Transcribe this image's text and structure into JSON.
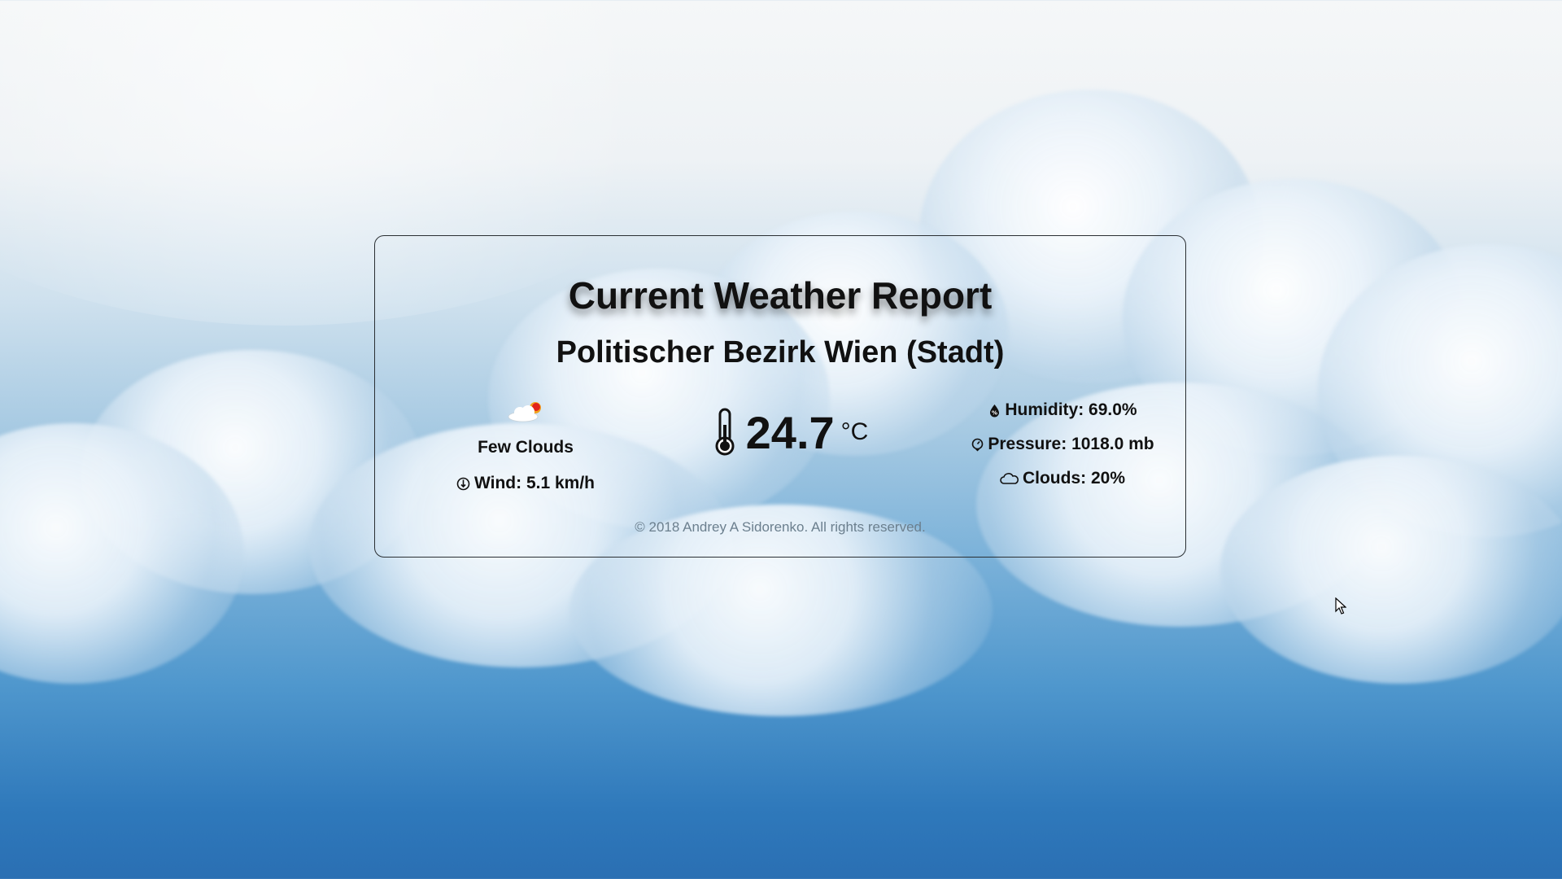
{
  "header": {
    "title": "Current Weather Report",
    "location": "Politischer Bezirk Wien (Stadt)"
  },
  "conditions": {
    "icon": "few-clouds-icon",
    "description": "Few Clouds",
    "wind_label": "Wind: 5.1 km/h"
  },
  "temperature": {
    "value": "24.7",
    "unit": "°C",
    "icon": "thermometer-icon"
  },
  "stats": {
    "humidity": "Humidity: 69.0%",
    "pressure": "Pressure: 1018.0 mb",
    "clouds": "Clouds: 20%"
  },
  "footer": {
    "copyright": "© 2018 Andrey A Sidorenko. All rights reserved."
  },
  "colors": {
    "text": "#111111",
    "footer_text": "#6b7f8e",
    "card_border": "#2a2f33",
    "sky_top": "#f5f7f8",
    "sky_bottom": "#2a6fb3"
  }
}
